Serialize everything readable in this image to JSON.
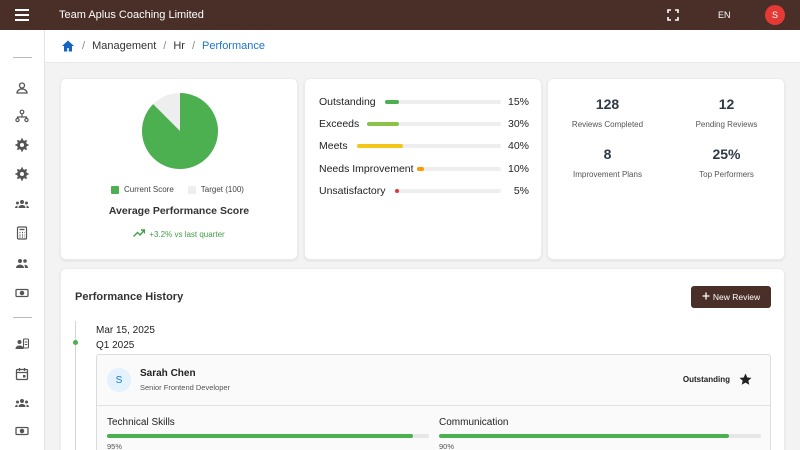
{
  "header": {
    "app_title": "Team Aplus Coaching Limited",
    "lang": "EN",
    "avatar_initial": "S",
    "fullscreen_icon": "fullscreen-icon",
    "menu_icon": "hamburger-menu-icon"
  },
  "sidebar": {
    "icons": [
      "user-icon",
      "org-chart-icon",
      "settings-icon",
      "settings-icon",
      "team-icon",
      "calculator-icon",
      "group-icon",
      "payments-icon",
      "contact-card-icon",
      "calendar-icon",
      "group-icon",
      "payments-icon"
    ]
  },
  "breadcrumb": {
    "items": [
      "Management",
      "Hr",
      "Performance"
    ]
  },
  "score_card": {
    "legend_current": "Current Score",
    "legend_target": "Target (100)",
    "title": "Average Performance Score",
    "trend": "+3.2% vs last quarter",
    "current_share": 0.875,
    "colors": {
      "current": "#4caf50",
      "target": "#eeeeee"
    }
  },
  "distribution": [
    {
      "label": "Outstanding",
      "pct": "15%",
      "value": 15,
      "color": "#4caf50"
    },
    {
      "label": "Exceeds",
      "pct": "30%",
      "value": 30,
      "color": "#8bc34a"
    },
    {
      "label": "Meets",
      "pct": "40%",
      "value": 40,
      "color": "#f5c518"
    },
    {
      "label": "Needs Improvement",
      "pct": "10%",
      "value": 10,
      "color": "#ff9800"
    },
    {
      "label": "Unsatisfactory",
      "pct": "5%",
      "value": 5,
      "color": "#e53935"
    }
  ],
  "stats": [
    {
      "value": "128",
      "label": "Reviews Completed"
    },
    {
      "value": "12",
      "label": "Pending Reviews"
    },
    {
      "value": "8",
      "label": "Improvement Plans"
    },
    {
      "value": "25%",
      "label": "Top Performers"
    }
  ],
  "history": {
    "title": "Performance History",
    "new_review_label": "New Review",
    "entry": {
      "date": "Mar 15, 2025",
      "period": "Q1 2025",
      "avatar_initial": "S",
      "name": "Sarah Chen",
      "role": "Senior Frontend Developer",
      "rating": "Outstanding",
      "skills": [
        {
          "label": "Technical Skills",
          "pct": "95%",
          "value": 95
        },
        {
          "label": "Communication",
          "pct": "90%",
          "value": 90
        }
      ]
    }
  }
}
